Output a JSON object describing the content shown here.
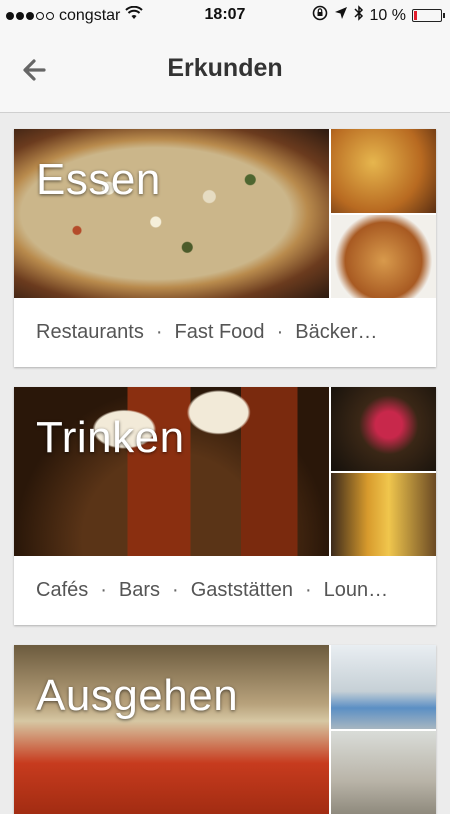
{
  "status_bar": {
    "carrier": "congstar",
    "time": "18:07",
    "battery": "10 %",
    "battery_level": 0.1,
    "icons": [
      "signal-dots",
      "wifi-icon",
      "rotation-lock-icon",
      "location-icon",
      "bluetooth-icon",
      "battery-icon"
    ]
  },
  "nav": {
    "title": "Erkunden",
    "back_icon": "back-arrow-icon"
  },
  "cards": [
    {
      "title": "Essen",
      "links": [
        "Restaurants",
        "Fast Food",
        "Bäcker…"
      ]
    },
    {
      "title": "Trinken",
      "links": [
        "Cafés",
        "Bars",
        "Gaststätten",
        "Loun…"
      ]
    },
    {
      "title": "Ausgehen",
      "links": []
    }
  ],
  "separator": "·",
  "colors": {
    "battery_low": "#e21d2d",
    "background": "#ececec"
  }
}
